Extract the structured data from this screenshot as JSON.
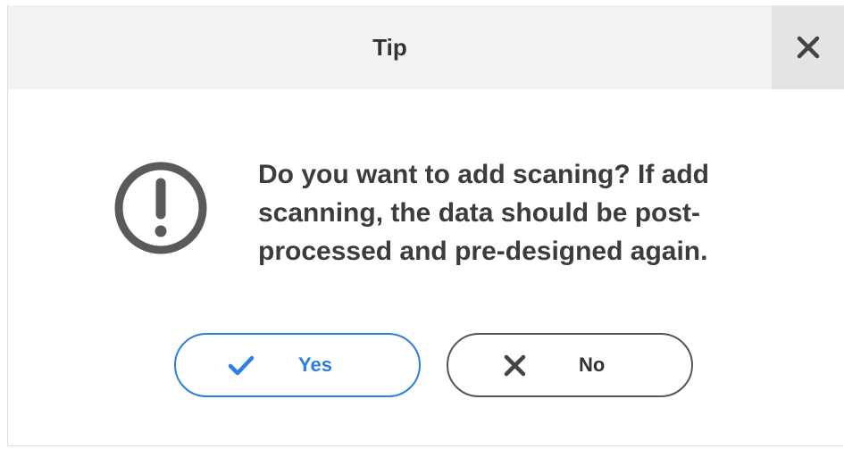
{
  "dialog": {
    "title": "Tip",
    "close_icon": "close-icon",
    "warning_icon": "exclamation-circle-icon",
    "message": "Do you want to add scaning? If add scanning, the data should be post-processed and pre-designed again.",
    "buttons": {
      "yes": {
        "label": "Yes",
        "icon": "check-icon",
        "color": "#2b7fe0"
      },
      "no": {
        "label": "No",
        "icon": "x-icon",
        "color": "#333333"
      }
    }
  }
}
